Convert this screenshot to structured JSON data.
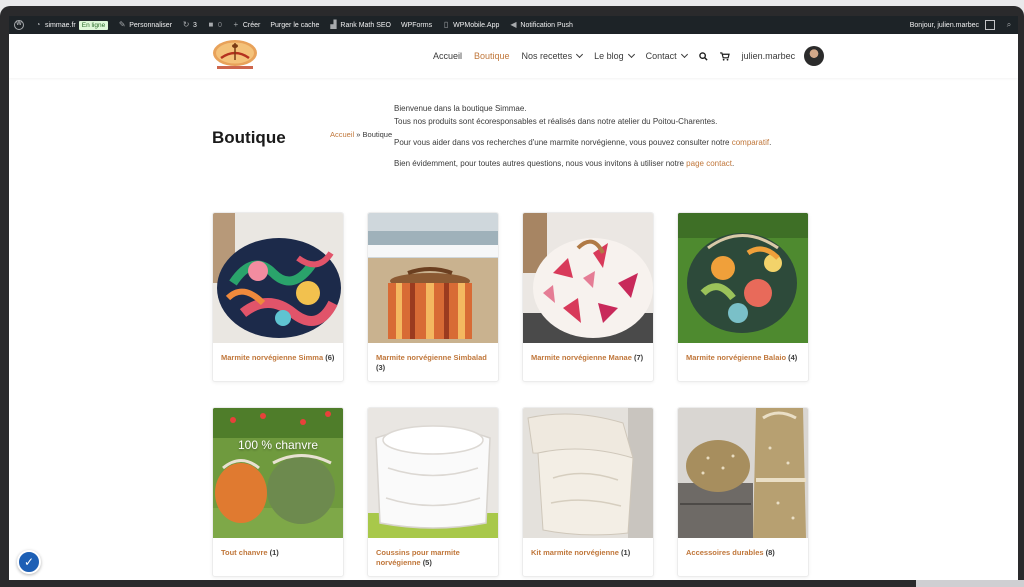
{
  "adminbar": {
    "site": "simmae.fr",
    "status": "En ligne",
    "customize": "Personnaliser",
    "updates_count": "3",
    "comments_count": "0",
    "new": "Créer",
    "purge": "Purger le cache",
    "rankmath": "Rank Math SEO",
    "wpforms": "WPForms",
    "wpmobile": "WPMobile.App",
    "push": "Notification Push",
    "greeting": "Bonjour, julien.marbec"
  },
  "nav": {
    "items": [
      "Accueil",
      "Boutique",
      "Nos recettes",
      "Le blog",
      "Contact"
    ],
    "user": "julien.marbec"
  },
  "page": {
    "title": "Boutique",
    "breadcrumb_home": "Accueil",
    "breadcrumb_sep": " » ",
    "breadcrumb_current": "Boutique",
    "intro_1": "Bienvenue dans la boutique Simmae.",
    "intro_2": "Tous nos produits sont  écoresponsables et réalisés dans notre atelier du Poitou-Charentes.",
    "intro_3": "Pour vous aider dans vos recherches d'une marmite norvégienne, vous pouvez consulter notre ",
    "intro_3_link": "comparatif",
    "intro_3_end": ".",
    "intro_4": "Bien évidemment, pour toutes autres questions, nous vous invitons à utiliser notre ",
    "intro_4_link": "page contact",
    "intro_4_end": "."
  },
  "categories": [
    {
      "name": "Marmite norvégienne Simma",
      "count": "(6)"
    },
    {
      "name": "Marmite norvégienne Simbalad",
      "count": "(3)"
    },
    {
      "name": "Marmite norvégienne Manae",
      "count": "(7)"
    },
    {
      "name": "Marmite norvégienne Balaio",
      "count": "(4)"
    },
    {
      "name": "Tout chanvre",
      "count": "(1)",
      "image_text": "100 % chanvre"
    },
    {
      "name": "Coussins pour marmite norvégienne",
      "count": "(5)"
    },
    {
      "name": "Kit marmite norvégienne",
      "count": "(1)"
    },
    {
      "name": "Accessoires durables",
      "count": "(8)"
    }
  ],
  "colors": {
    "accent": "#c0773b",
    "adminbar": "#1d2327",
    "text": "#3a3a3a"
  }
}
